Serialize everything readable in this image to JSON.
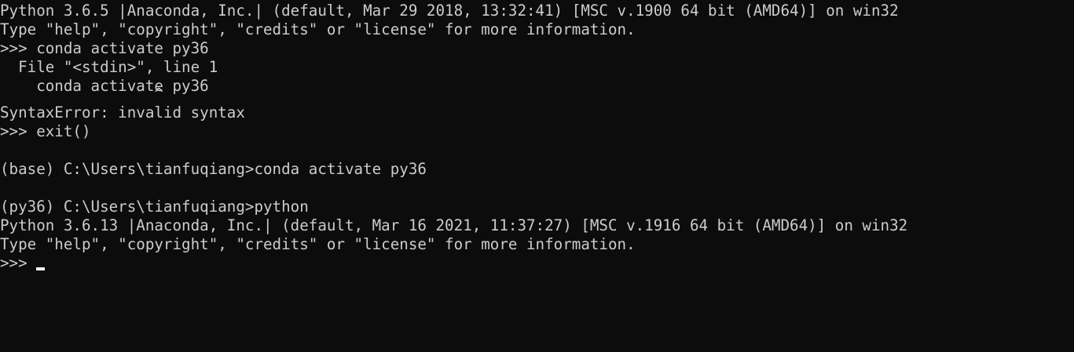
{
  "colors": {
    "background": "#0c0c0c",
    "foreground": "#cccccc",
    "cursor": "#f2f2f2"
  },
  "terminal": {
    "lines": [
      "Python 3.6.5 |Anaconda, Inc.| (default, Mar 29 2018, 13:32:41) [MSC v.1900 64 bit (AMD64)] on win32",
      "Type \"help\", \"copyright\", \"credits\" or \"license\" for more information.",
      ">>> conda activate py36",
      "  File \"<stdin>\", line 1",
      "    conda activate py36",
      "                 ^",
      "SyntaxError: invalid syntax",
      ">>> exit()",
      "",
      "(base) C:\\Users\\tianfuqiang>conda activate py36",
      "",
      "(py36) C:\\Users\\tianfuqiang>python",
      "Python 3.6.13 |Anaconda, Inc.| (default, Mar 16 2021, 11:37:27) [MSC v.1916 64 bit (AMD64)] on win32",
      "Type \"help\", \"copyright\", \"credits\" or \"license\" for more information."
    ],
    "prompt": ">>> "
  }
}
